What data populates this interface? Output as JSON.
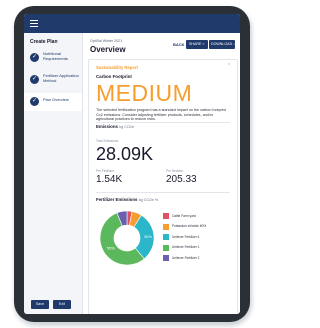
{
  "sidebar": {
    "title": "Create Plan",
    "steps": [
      {
        "label": "Nutritional Requirements",
        "check": "✓"
      },
      {
        "label": "Fertilizer Application Method",
        "check": "✓"
      },
      {
        "label": "Plan Overview",
        "check": "✓"
      }
    ],
    "save_label": "Save",
    "exit_label": "Exit"
  },
  "header": {
    "crumb": "OptiSal Winter 2021",
    "title": "Overview",
    "back_label": "BACK",
    "share_label": "SHARE",
    "download_label": "DOWNLOAD"
  },
  "report": {
    "heading": "Sustainability Report",
    "carbon_title": "Carbon Footprint",
    "rating": "MEDIUM",
    "description": "The selected fertilization program has a standard impact on the carbon footprint Co2 emissions. Consider adjusting fertilizer products, schedules, and/or agricultural practices to reduce risks."
  },
  "emissions": {
    "title": "Emissions",
    "unit": "kg CO2e",
    "total_label": "Total Emissions",
    "total_value": "28.09K",
    "fertilizer_label": "Per Fertilizer",
    "fertilizer_value": "1.54K",
    "hectare_label": "Per Hectare",
    "hectare_value": "205.33"
  },
  "chart_data": {
    "type": "pie",
    "title": "Fertilizer Emissions",
    "unit": "kg CO2e %",
    "series": [
      {
        "name": "Cattle Farm yard",
        "value": 3,
        "color": "#e05263"
      },
      {
        "name": "Potassium chloride 60%",
        "value": 6,
        "color": "#f59e2f"
      },
      {
        "name": "Unilever Fertilizer 4",
        "value": 30,
        "color": "#2bb6c9"
      },
      {
        "name": "Unilever Fertilizer 1",
        "value": 55,
        "color": "#5cb85c"
      },
      {
        "name": "Unilever Fertilizer 2",
        "value": 6,
        "color": "#6b5fb0"
      }
    ],
    "labels_on_chart": [
      "30%",
      "55%"
    ]
  }
}
